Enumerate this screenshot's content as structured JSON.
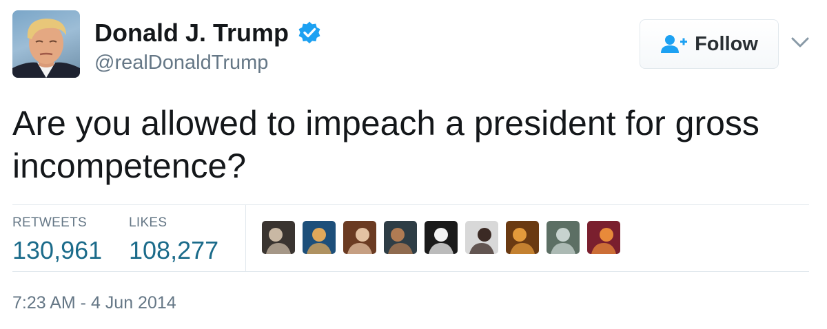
{
  "user": {
    "display_name": "Donald J. Trump",
    "screen_name": "@realDonaldTrump",
    "verified": true,
    "avatar_icon": "profile-photo"
  },
  "follow_button": {
    "label": "Follow",
    "icon": "add-user-icon"
  },
  "tweet": {
    "text": "Are you allowed to impeach a president for gross incompetence?"
  },
  "stats": {
    "retweets_label": "RETWEETS",
    "retweets_value": "130,961",
    "likes_label": "LIKES",
    "likes_value": "108,277"
  },
  "likers": [
    {
      "icon": "liker-avatar",
      "colors": [
        "#3a3430",
        "#c9b8a4"
      ]
    },
    {
      "icon": "liker-avatar",
      "colors": [
        "#1d4f7a",
        "#e0a85a"
      ]
    },
    {
      "icon": "liker-avatar",
      "colors": [
        "#6b3b22",
        "#e4c2a3"
      ]
    },
    {
      "icon": "liker-avatar",
      "colors": [
        "#2e3d45",
        "#b07b53"
      ]
    },
    {
      "icon": "liker-avatar",
      "colors": [
        "#1a1a1a",
        "#f2f2f2"
      ]
    },
    {
      "icon": "liker-avatar",
      "colors": [
        "#d8d8d8",
        "#3b2a24"
      ]
    },
    {
      "icon": "liker-avatar",
      "colors": [
        "#6a3a12",
        "#e39a3b"
      ]
    },
    {
      "icon": "liker-avatar",
      "colors": [
        "#5c6f64",
        "#c7d3cf"
      ]
    },
    {
      "icon": "liker-avatar",
      "colors": [
        "#7a1f2e",
        "#e88a3a"
      ]
    }
  ],
  "timestamp": "7:23 AM - 4 Jun 2014",
  "colors": {
    "verified_blue": "#1da1f2",
    "stat_value": "#1b6b8a",
    "muted_text": "#657786",
    "divider": "#e1e8ed"
  }
}
